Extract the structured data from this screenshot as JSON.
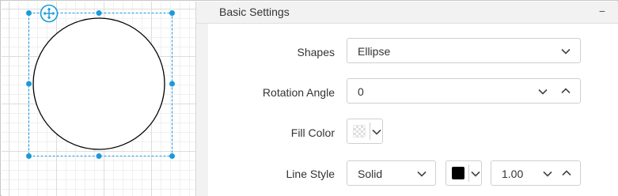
{
  "panel": {
    "title": "Basic Settings",
    "collapse_glyph": "−"
  },
  "properties": {
    "shapes": {
      "label": "Shapes",
      "value": "Ellipse"
    },
    "rotation_angle": {
      "label": "Rotation Angle",
      "value": "0"
    },
    "fill_color": {
      "label": "Fill Color",
      "color": "transparent"
    },
    "line_style": {
      "label": "Line Style",
      "style_value": "Solid",
      "color": "#000000",
      "width_value": "1.00"
    }
  },
  "colors": {
    "selection_accent": "#1a9ad9",
    "shape_stroke": "#000000",
    "panel_background": "#f2f2f2"
  },
  "icons": {
    "move_handle": "move-arrows-icon",
    "dropdown": "chevron-down-icon",
    "spin_up": "chevron-up-icon"
  }
}
